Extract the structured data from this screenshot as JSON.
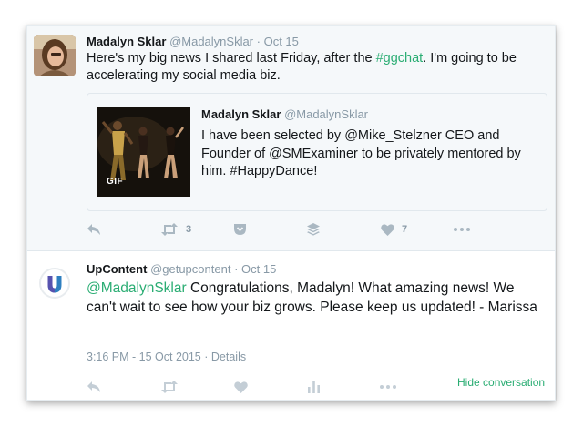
{
  "tweet": {
    "author_name": "Madalyn Sklar",
    "author_handle": "@MadalynSklar",
    "date": "· Oct 15",
    "text_before": "Here's my big news I shared last Friday, after the ",
    "hashtag": "#ggchat",
    "text_after": ". I'm going to be accelerating my social media biz.",
    "quoted": {
      "author_name": "Madalyn Sklar",
      "author_handle": "@MadalynSklar",
      "text": "I have been selected by @Mike_Stelzner CEO and Founder of @SMExaminer to be privately mentored by him. #HappyDance!",
      "media_badge": "GIF"
    },
    "actions": {
      "reply_icon": "reply-icon",
      "retweet_icon": "retweet-icon",
      "retweet_count": "3",
      "pocket_icon": "pocket-icon",
      "buffer_icon": "buffer-icon",
      "like_icon": "heart-icon",
      "like_count": "7",
      "more_icon": "more-icon"
    }
  },
  "reply": {
    "author_name": "UpContent",
    "author_handle": "@getupcontent",
    "date": "· Oct 15",
    "mention": "@MadalynSklar",
    "text": " Congratulations, Madalyn! What amazing news! We can't wait to see how your biz grows. Please keep us updated! - Marissa",
    "timestamp": "3:16 PM - 15 Oct 2015",
    "details_link": "· Details",
    "hide_conversation": "Hide conversation",
    "actions": {
      "reply_icon": "reply-icon",
      "retweet_icon": "retweet-icon",
      "like_icon": "heart-icon",
      "analytics_icon": "analytics-icon",
      "more_icon": "more-icon"
    }
  },
  "colors": {
    "link": "#2aad73",
    "meta": "#8899a6",
    "icon": "#aab8c2",
    "tweet_bg": "#f5f8fa"
  }
}
